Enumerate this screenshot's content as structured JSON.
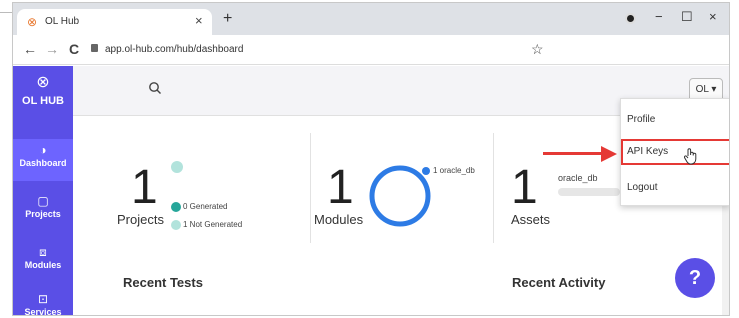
{
  "browser": {
    "tab_title": "OL Hub",
    "tab_close": "×",
    "new_tab": "+",
    "url": "app.ol-hub.com/hub/dashboard",
    "nav_back": "←",
    "nav_forward": "→",
    "nav_reload": "C",
    "bookmark": "☆",
    "window_minimize": "−",
    "window_restore": "☐",
    "window_close": "×"
  },
  "sidebar": {
    "logo": "OL HUB",
    "items": [
      {
        "label": "Dashboard",
        "icon": "dashboard-icon",
        "glyph": "◑",
        "active": true
      },
      {
        "label": "Projects",
        "icon": "projects-icon",
        "glyph": "▢",
        "active": false
      },
      {
        "label": "Modules",
        "icon": "modules-icon",
        "glyph": "⧈",
        "active": false
      },
      {
        "label": "Services",
        "icon": "services-icon",
        "glyph": "⊡",
        "active": false
      }
    ]
  },
  "topbar": {
    "user_button": "OL ▾"
  },
  "cards": {
    "projects": {
      "value": "1",
      "label": "Projects",
      "generated": "0 Generated",
      "not_generated": "1 Not Generated"
    },
    "modules": {
      "value": "1",
      "label": "Modules",
      "legend": "1 oracle_db"
    },
    "assets": {
      "value": "1",
      "label": "Assets",
      "legend": "oracle_db"
    }
  },
  "sections": {
    "recent_tests": "Recent Tests",
    "recent_activity": "Recent Activity"
  },
  "user_menu": {
    "items": [
      "Profile",
      "API Keys",
      "Logout"
    ],
    "highlighted": "API Keys"
  },
  "help_button": "?",
  "colors": {
    "sidebar": "#5a4fe6",
    "teal_generated": "#26a69a",
    "teal_light": "#b2e3dc",
    "ring_blue": "#2d7be5",
    "highlight_red": "#e53935"
  }
}
